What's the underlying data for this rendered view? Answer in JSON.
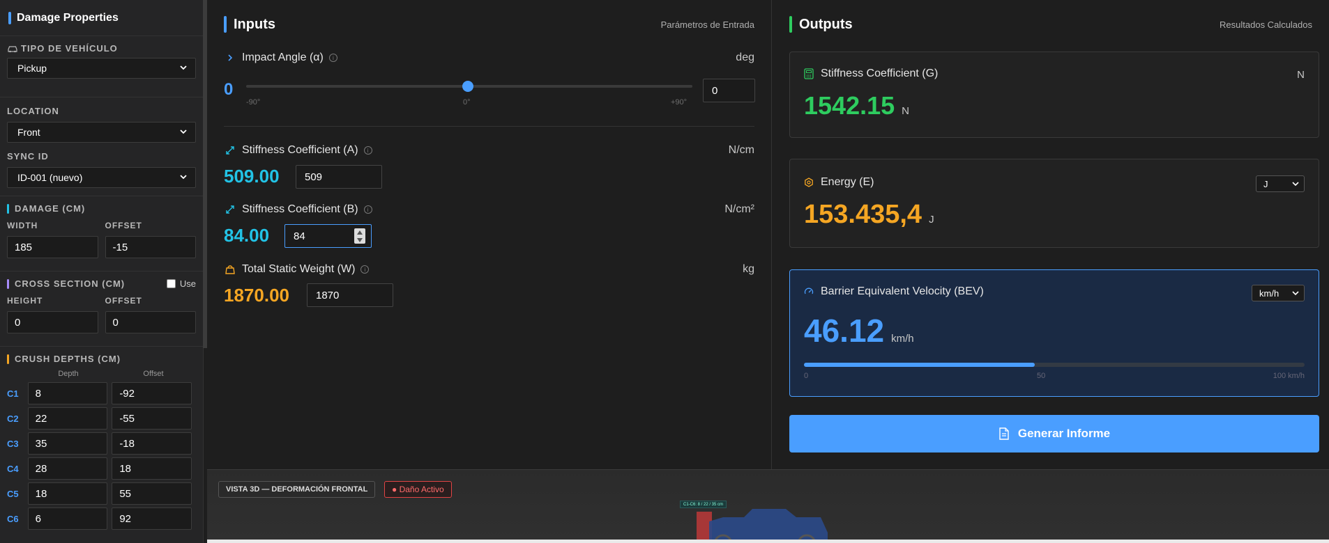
{
  "sidebar": {
    "title": "Damage Properties",
    "vehicle_type": {
      "label": "TIPO DE VEHÍCULO",
      "value": "Pickup"
    },
    "location": {
      "label": "LOCATION",
      "value": "Front"
    },
    "sync": {
      "label": "SYNC ID",
      "value": "ID-001 (nuevo)"
    },
    "damage": {
      "label": "DAMAGE (CM)",
      "width_label": "WIDTH",
      "width": "185",
      "offset_label": "OFFSET",
      "offset": "-15"
    },
    "cross": {
      "label": "CROSS SECTION (CM)",
      "use_label": "Use",
      "height_label": "HEIGHT",
      "height": "0",
      "offset_label": "OFFSET",
      "offset": "0"
    },
    "crush": {
      "label": "CRUSH DEPTHS (CM)",
      "depth_header": "Depth",
      "offset_header": "Offset",
      "rows": [
        {
          "label": "C1",
          "depth": "8",
          "offset": "-92"
        },
        {
          "label": "C2",
          "depth": "22",
          "offset": "-55"
        },
        {
          "label": "C3",
          "depth": "35",
          "offset": "-18"
        },
        {
          "label": "C4",
          "depth": "28",
          "offset": "18"
        },
        {
          "label": "C5",
          "depth": "18",
          "offset": "55"
        },
        {
          "label": "C6",
          "depth": "6",
          "offset": "92"
        }
      ]
    }
  },
  "inputs": {
    "title": "Inputs",
    "subtitle": "Parámetros de Entrada",
    "angle": {
      "label": "Impact Angle (α)",
      "unit": "deg",
      "value": "0",
      "field": "0",
      "tick_min": "-90°",
      "tick_mid": "0°",
      "tick_max": "+90°",
      "slider_fraction": 0.5
    },
    "stiff_a": {
      "label": "Stiffness Coefficient (A)",
      "unit": "N/cm",
      "value": "509.00",
      "field": "509"
    },
    "stiff_b": {
      "label": "Stiffness Coefficient (B)",
      "unit": "N/cm²",
      "value": "84.00",
      "field": "84"
    },
    "weight": {
      "label": "Total Static Weight (W)",
      "unit": "kg",
      "value": "1870.00",
      "field": "1870"
    }
  },
  "outputs": {
    "title": "Outputs",
    "subtitle": "Resultados Calculados",
    "g": {
      "label": "Stiffness Coefficient (G)",
      "unit": "N",
      "value": "1542.15",
      "value_unit": "N"
    },
    "e": {
      "label": "Energy (E)",
      "unit_select": "J",
      "value": "153.435,4",
      "value_unit": "J"
    },
    "bev": {
      "label": "Barrier Equivalent Velocity (BEV)",
      "unit_select": "km/h",
      "value": "46.12",
      "value_unit": "km/h",
      "scale_min": "0",
      "scale_mid": "50",
      "scale_max": "100 km/h",
      "progress_fraction": 0.4612
    },
    "generate_label": "Generar Informe"
  },
  "view3d": {
    "label": "VISTA 3D — DEFORMACIÓN FRONTAL",
    "badge": "● Daño Activo",
    "tag": "C1-C6: 8 / 22 / 35 cm"
  },
  "colors": {
    "accent": "#4a9eff",
    "cyan": "#22c3e6",
    "green": "#2ecc5f",
    "orange": "#f5a623",
    "purple": "#a78bfa",
    "red": "#e24444"
  }
}
